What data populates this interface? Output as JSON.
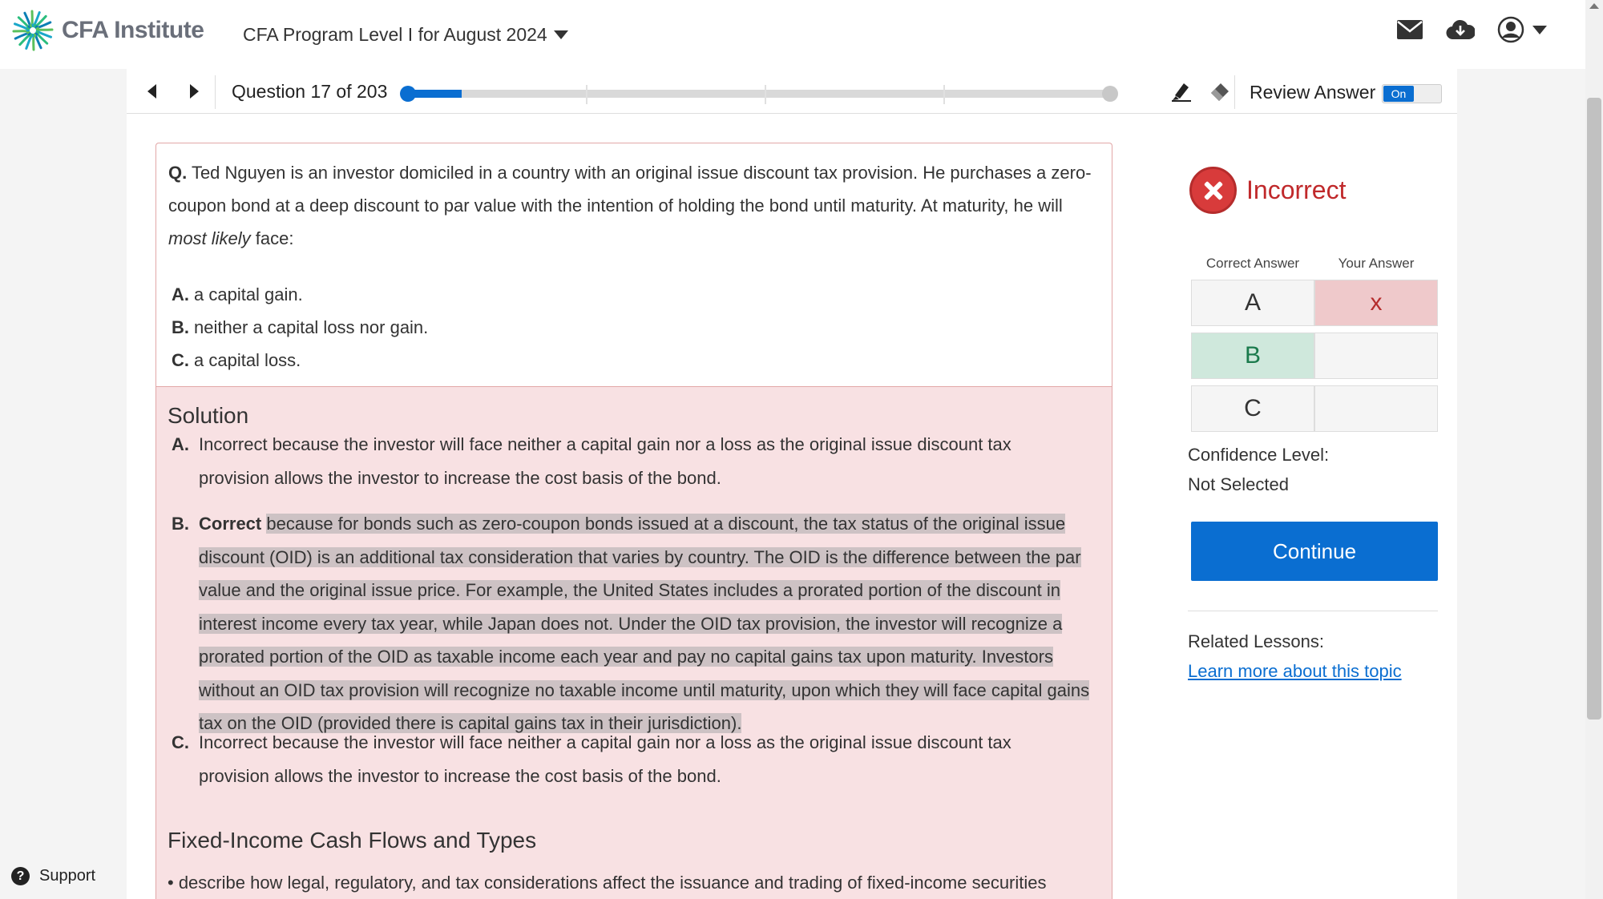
{
  "header": {
    "logo_text": "CFA Institute",
    "program_label": "CFA Program Level I for August 2024",
    "icons": [
      "mail-icon",
      "cloud-download-icon",
      "user-account-icon",
      "chevron-down-icon"
    ]
  },
  "question_bar": {
    "counter": "Question 17 of 203",
    "progress_fraction": 0.084,
    "review_label": "Review Answer",
    "toggle_label": "On"
  },
  "question": {
    "prefix": "Q.",
    "text_before": " Ted Nguyen is an investor domiciled in a country with an original issue discount tax provision. He purchases a zero-coupon bond at a deep discount to par value with the intention of holding the bond until maturity. At maturity, he will ",
    "emphasis": "most likely",
    "text_after": " face:",
    "options": [
      {
        "letter": "A.",
        "text": "a capital gain."
      },
      {
        "letter": "B.",
        "text": "neither a capital loss nor gain."
      },
      {
        "letter": "C.",
        "text": "a capital loss."
      }
    ]
  },
  "solution": {
    "title": "Solution",
    "a_letter": "A.",
    "a_text": "Incorrect because the investor will face neither a capital gain nor a loss as the original issue discount tax provision allows the investor to increase the cost basis of the bond.",
    "b_letter": "B.",
    "b_lead": "Correct",
    "b_text": "because for bonds such as zero-coupon bonds issued at a discount, the tax status of the original issue discount (OID) is an additional tax consideration that varies by country. The OID is the difference between the par value and the original issue price. For example, the United States includes a prorated portion of the discount in interest income every tax year, while Japan does not. Under the OID tax provision, the investor will recognize a prorated portion of the OID as taxable income each year and pay no capital gains tax upon maturity. Investors without an OID tax provision will recognize no taxable income until maturity, upon which they will face capital gains tax on the OID (provided there is capital gains tax in their jurisdiction).",
    "c_letter": "C.",
    "c_text": "Incorrect because the investor will face neither a capital gain nor a loss as the original issue discount tax provision allows the investor to increase the cost basis of the bond."
  },
  "topic": {
    "title": "Fixed-Income Cash Flows and Types",
    "item": "• describe how legal, regulatory, and tax considerations affect the issuance and trading of fixed-income securities"
  },
  "result": {
    "label": "Incorrect",
    "correct_answer_header": "Correct Answer",
    "your_answer_header": "Your Answer",
    "rows": [
      {
        "letter": "A",
        "yours": "x"
      },
      {
        "letter": "B",
        "yours": ""
      },
      {
        "letter": "C",
        "yours": ""
      }
    ],
    "correct_letter": "B",
    "confidence_label": "Confidence Level:",
    "confidence_value": "Not Selected",
    "continue_label": "Continue",
    "related_label": "Related Lessons:",
    "related_link": "Learn more about this topic"
  },
  "support": {
    "label": "Support",
    "icon_glyph": "?"
  },
  "colors": {
    "accent": "#0a6ed1",
    "incorrect": "#c0292b",
    "correct_bg": "#cfe8dc",
    "wrong_bg": "#efc9cb",
    "solution_bg": "#f8e1e3"
  }
}
